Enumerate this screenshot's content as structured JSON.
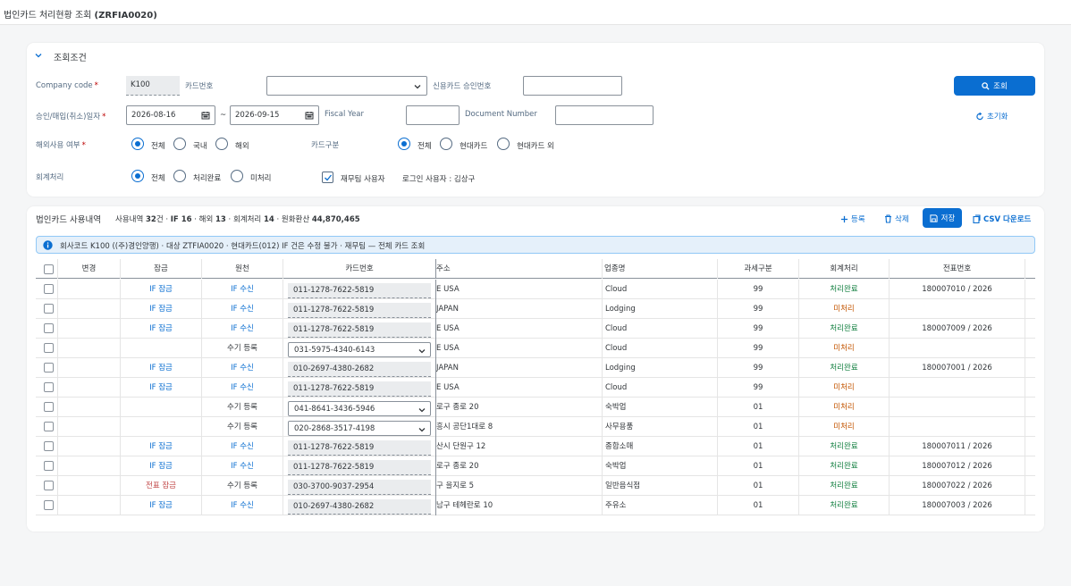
{
  "header": {
    "title": "법인카드 처리현황 조회",
    "code": "(ZRFIA0020)"
  },
  "filter": {
    "section_title": "조회조건",
    "company_code_label": "Company code",
    "company_code_value": "K100",
    "card_no_label": "카드번호",
    "card_no_value": "",
    "approval_label": "신용카드 승인번호",
    "approval_value": "",
    "date_label": "승인/매입(취소)일자",
    "date_from": "2026-08-16",
    "date_sep": "~",
    "date_to": "2026-09-15",
    "fiscal_year_label": "Fiscal Year",
    "fiscal_year_value": "",
    "doc_number_label": "Document Number",
    "doc_number_value": "",
    "overseas_label": "해외사용 여부",
    "overseas_options": [
      "전체",
      "국내",
      "해외"
    ],
    "card_type_label": "카드구분",
    "card_type_options": [
      "전체",
      "현대카드",
      "현대카드 외"
    ],
    "accounting_label": "회계처리",
    "accounting_options": [
      "전체",
      "처리완료",
      "미처리"
    ],
    "finance_team_label": "재무팀 사용자",
    "login_user_label": "로그인 사용자 : 김상구",
    "search_label": "조회",
    "reset_label": "초기화"
  },
  "results": {
    "title": "법인카드 사용내역",
    "summary": {
      "p1": "사용내역 ",
      "total": "32",
      "p2": "건 · ",
      "if_label": "IF ",
      "if": "16",
      "p3": " · 해외 ",
      "overseas": "13",
      "p4": " · 회계처리 ",
      "acct": "14",
      "p5": " · 원화환산 ",
      "krw": "44,870,465"
    },
    "register_label": "등록",
    "delete_label": "삭제",
    "save_label": "저장",
    "csv_label": "CSV 다운로드",
    "info_text": "회사코드 K100 ((주)경인양행) · 대상 ZTFIA0020 · 현대카드(012) IF 건은 수정 불가 · 재무팀 — 전체 카드 조회",
    "columns": [
      "변경",
      "잠금",
      "원천",
      "카드번호",
      "주소",
      "업종명",
      "과세구분",
      "회계처리",
      "전표번호"
    ],
    "rows": [
      {
        "lock": "IF 잠금",
        "lock_color": "blue",
        "source": "IF 수신",
        "source_color": "blue",
        "card": "011-1278-7622-5819",
        "dd": false,
        "addr": "E USA",
        "biz": "Cloud",
        "tax": "99",
        "acct": "처리완료",
        "acct_color": "green",
        "doc": "180007010 / 2026"
      },
      {
        "lock": "IF 잠금",
        "lock_color": "blue",
        "source": "IF 수신",
        "source_color": "blue",
        "card": "011-1278-7622-5819",
        "dd": false,
        "addr": "JAPAN",
        "biz": "Lodging",
        "tax": "99",
        "acct": "미처리",
        "acct_color": "amber",
        "doc": ""
      },
      {
        "lock": "IF 잠금",
        "lock_color": "blue",
        "source": "IF 수신",
        "source_color": "blue",
        "card": "011-1278-7622-5819",
        "dd": false,
        "addr": "E USA",
        "biz": "Cloud",
        "tax": "99",
        "acct": "처리완료",
        "acct_color": "green",
        "doc": "180007009 / 2026"
      },
      {
        "lock": "",
        "lock_color": "",
        "source": "수기 등록",
        "source_color": "",
        "card": "031-5975-4340-6143",
        "dd": true,
        "addr": "E USA",
        "biz": "Cloud",
        "tax": "99",
        "acct": "미처리",
        "acct_color": "amber",
        "doc": ""
      },
      {
        "lock": "IF 잠금",
        "lock_color": "blue",
        "source": "IF 수신",
        "source_color": "blue",
        "card": "010-2697-4380-2682",
        "dd": false,
        "addr": "JAPAN",
        "biz": "Lodging",
        "tax": "99",
        "acct": "처리완료",
        "acct_color": "green",
        "doc": "180007001 / 2026"
      },
      {
        "lock": "IF 잠금",
        "lock_color": "blue",
        "source": "IF 수신",
        "source_color": "blue",
        "card": "011-1278-7622-5819",
        "dd": false,
        "addr": "E USA",
        "biz": "Cloud",
        "tax": "99",
        "acct": "미처리",
        "acct_color": "amber",
        "doc": ""
      },
      {
        "lock": "",
        "lock_color": "",
        "source": "수기 등록",
        "source_color": "",
        "card": "041-8641-3436-5946",
        "dd": true,
        "addr": "로구 종로 20",
        "biz": "숙박업",
        "tax": "01",
        "acct": "미처리",
        "acct_color": "amber",
        "doc": ""
      },
      {
        "lock": "",
        "lock_color": "",
        "source": "수기 등록",
        "source_color": "",
        "card": "020-2868-3517-4198",
        "dd": true,
        "addr": "흥시 공단1대로 8",
        "biz": "사무용품",
        "tax": "01",
        "acct": "미처리",
        "acct_color": "amber",
        "doc": ""
      },
      {
        "lock": "IF 잠금",
        "lock_color": "blue",
        "source": "IF 수신",
        "source_color": "blue",
        "card": "011-1278-7622-5819",
        "dd": false,
        "addr": "산시 단원구 12",
        "biz": "종합소매",
        "tax": "01",
        "acct": "처리완료",
        "acct_color": "green",
        "doc": "180007011 / 2026"
      },
      {
        "lock": "IF 잠금",
        "lock_color": "blue",
        "source": "IF 수신",
        "source_color": "blue",
        "card": "011-1278-7622-5819",
        "dd": false,
        "addr": "로구 종로 20",
        "biz": "숙박업",
        "tax": "01",
        "acct": "처리완료",
        "acct_color": "green",
        "doc": "180007012 / 2026"
      },
      {
        "lock": "전표 잠금",
        "lock_color": "orange",
        "source": "수기 등록",
        "source_color": "",
        "card": "030-3700-9037-2954",
        "dd": false,
        "addr": "구 을지로 5",
        "biz": "일반음식점",
        "tax": "01",
        "acct": "처리완료",
        "acct_color": "green",
        "doc": "180007022 / 2026"
      },
      {
        "lock": "IF 잠금",
        "lock_color": "blue",
        "source": "IF 수신",
        "source_color": "blue",
        "card": "010-2697-4380-2682",
        "dd": false,
        "addr": "남구 테헤란로 10",
        "biz": "주유소",
        "tax": "01",
        "acct": "처리완료",
        "acct_color": "green",
        "doc": "180007003 / 2026"
      }
    ]
  }
}
